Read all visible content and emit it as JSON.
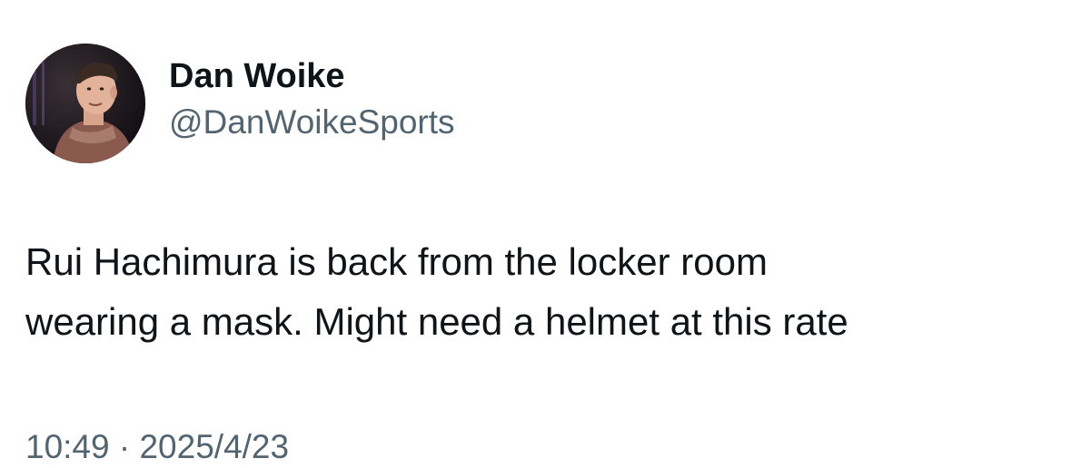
{
  "author": {
    "display_name": "Dan Woike",
    "handle": "@DanWoikeSports",
    "avatar_icon": "profile-photo"
  },
  "tweet": {
    "text_lines": [
      "Rui Hachimura is back from the locker room",
      "wearing a mask. Might need a helmet at this rate"
    ],
    "time": "10:49",
    "separator": "·",
    "date": "2025/4/23"
  },
  "colors": {
    "text_primary": "#0f1419",
    "text_secondary": "#536471",
    "background": "#ffffff"
  }
}
